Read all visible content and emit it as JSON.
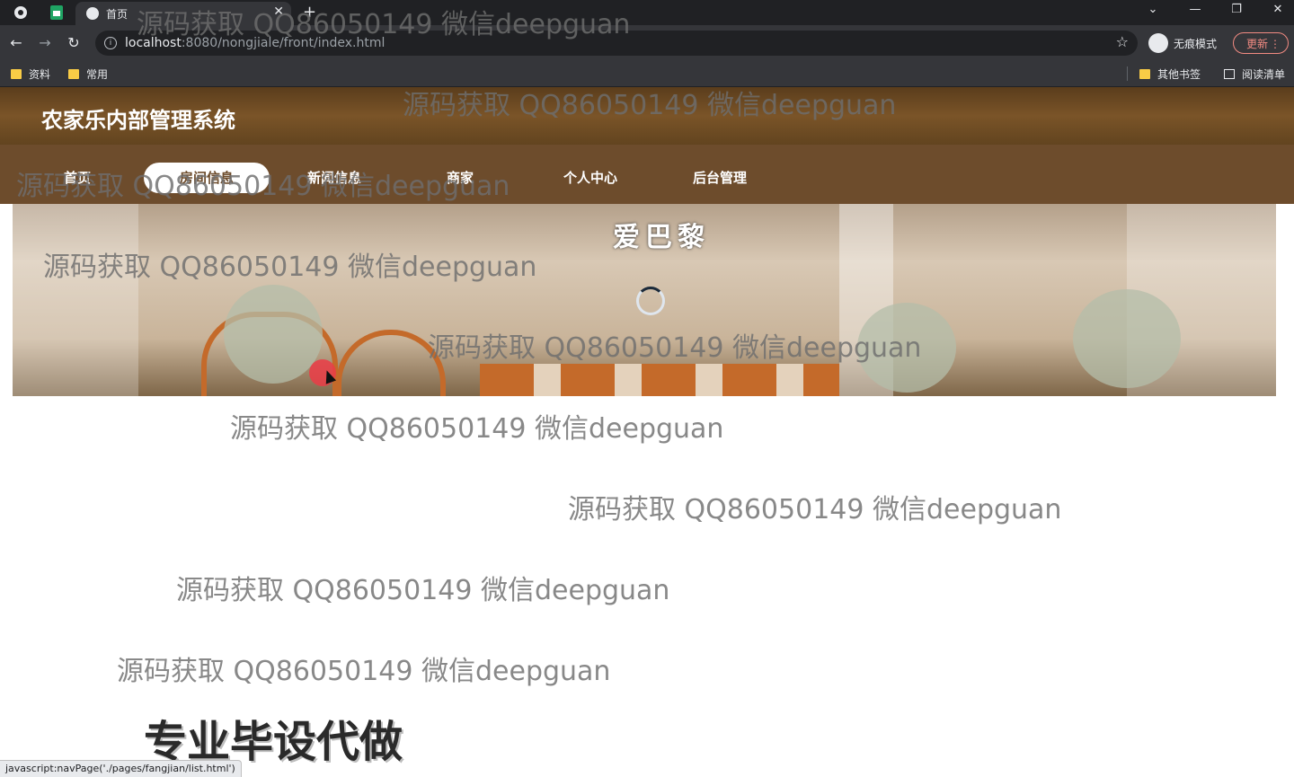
{
  "browser": {
    "tab_title": "首页",
    "url_host": "localhost",
    "url_rest": ":8080/nongjiale/front/index.html",
    "incognito_label": "无痕模式",
    "update_label": "更新",
    "bookmarks": [
      "资料",
      "常用"
    ],
    "other_bookmarks": "其他书签",
    "reading_list": "阅读清单",
    "status_url": "javascript:navPage('./pages/fangjian/list.html')"
  },
  "site": {
    "title": "农家乐内部管理系统",
    "nav": [
      {
        "label": "首页"
      },
      {
        "label": "房间信息"
      },
      {
        "label": "新闻信息"
      },
      {
        "label": "商家"
      },
      {
        "label": "个人中心"
      },
      {
        "label": "后台管理"
      }
    ],
    "banner_sign": "爱巴黎"
  },
  "overlay": {
    "watermark": "源码获取 QQ86050149 微信deepguan",
    "promo": "专业毕设代做"
  },
  "colors": {
    "header_brown": "#6d4c2c",
    "chrome_dark": "#202124",
    "accent_orange": "#c46a2a"
  }
}
